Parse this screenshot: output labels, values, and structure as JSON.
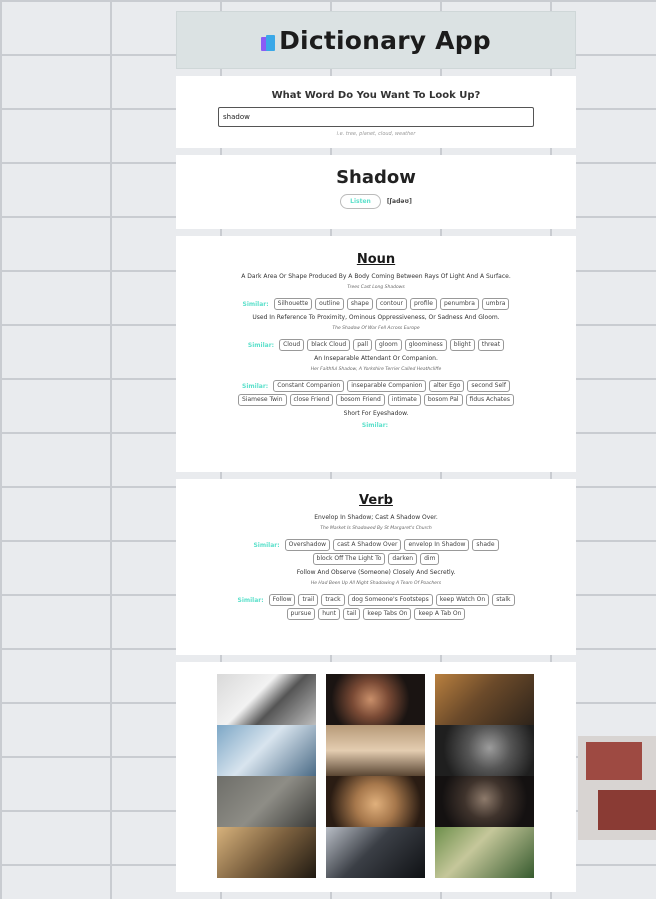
{
  "header": {
    "title": "Dictionary App",
    "icon": "books-icon"
  },
  "search": {
    "question": "What Word Do You Want To Look Up?",
    "value": "shadow",
    "hint": "i.e. tree, planet, cloud, weather"
  },
  "word": {
    "title": "Shadow",
    "listen_label": "Listen",
    "phonetic": "[ʃadəʊ]"
  },
  "noun": {
    "pos": "Noun",
    "similar_label": "Similar:",
    "meanings": [
      {
        "definition": "A Dark Area Or Shape Produced By A Body Coming Between Rays Of Light And A Surface.",
        "example": "Trees Cast Long Shadows",
        "synonyms": [
          "Silhouette",
          "outline",
          "shape",
          "contour",
          "profile",
          "penumbra",
          "umbra"
        ]
      },
      {
        "definition": "Used In Reference To Proximity, Ominous Oppressiveness, Or Sadness And Gloom.",
        "example": "The Shadow Of War Fell Across Europe",
        "synonyms": [
          "Cloud",
          "black Cloud",
          "pall",
          "gloom",
          "gloominess",
          "blight",
          "threat"
        ]
      },
      {
        "definition": "An Inseparable Attendant Or Companion.",
        "example": "Her Faithful Shadow, A Yorkshire Terrier Called Heathcliffe",
        "synonyms": [
          "Constant Companion",
          "inseparable Companion",
          "alter Ego",
          "second Self",
          "Siamese Twin",
          "close Friend",
          "bosom Friend",
          "intimate",
          "bosom Pal",
          "fidus Achates"
        ]
      },
      {
        "definition": "Short For Eyeshadow.",
        "example": "",
        "synonyms": []
      }
    ]
  },
  "verb": {
    "pos": "Verb",
    "similar_label": "Similar:",
    "meanings": [
      {
        "definition": "Envelop In Shadow; Cast A Shadow Over.",
        "example": "The Market Is Shadowed By St Margaret's Church",
        "synonyms": [
          "Overshadow",
          "cast A Shadow Over",
          "envelop In Shadow",
          "shade",
          "block Off The Light To",
          "darken",
          "dim"
        ]
      },
      {
        "definition": "Follow And Observe (Someone) Closely And Secretly.",
        "example": "He Had Been Up All Night Shadowing A Team Of Poachers",
        "synonyms": [
          "Follow",
          "trail",
          "track",
          "dog Someone's Footsteps",
          "keep Watch On",
          "stalk",
          "pursue",
          "hunt",
          "tail",
          "keep Tabs On",
          "keep A Tab On"
        ]
      }
    ]
  },
  "gallery": {
    "photos": [
      {
        "name": "photo-building-shadows",
        "bg": "linear-gradient(135deg,#d9d9d9 0%,#f2f2f2 40%,#555 60%,#bdbdbd 100%)"
      },
      {
        "name": "photo-face-light-pattern",
        "bg": "radial-gradient(circle at 45% 50%,#c98f6a 0%,#7a4a35 30%,#1a1412 65%)"
      },
      {
        "name": "photo-desk-objects",
        "bg": "linear-gradient(135deg,#b9803f 0%,#6b4a2a 45%,#2d231a 100%)"
      },
      {
        "name": "photo-woman-lying",
        "bg": "linear-gradient(135deg,#7da7c6 0%,#d8e4ee 45%,#4b6b86 100%)"
      },
      {
        "name": "photo-woman-standing",
        "bg": "linear-gradient(180deg,#b79a78 0%,#e4cdb1 50%,#5a4633 100%)"
      },
      {
        "name": "photo-portrait-dark",
        "bg": "radial-gradient(circle at 55% 45%,#9c9c9c 0%,#555 35%,#1f1f1f 75%)"
      },
      {
        "name": "photo-shadow-on-wall",
        "bg": "linear-gradient(135deg,#6e6e69 0%,#8e8d86 50%,#3b3b38 100%)"
      },
      {
        "name": "photo-hands-sunlight",
        "bg": "radial-gradient(circle at 50% 55%,#e0b07c 0%,#a7784c 35%,#2a1c13 80%)"
      },
      {
        "name": "photo-man-dark",
        "bg": "radial-gradient(circle at 50% 45%,#8d7a6b 0%,#3f332c 35%,#141111 75%)"
      },
      {
        "name": "photo-street-shadows",
        "bg": "linear-gradient(135deg,#d7b27c 0%,#7a5f3e 50%,#1f1911 100%)"
      },
      {
        "name": "photo-dark-silhouette",
        "bg": "linear-gradient(135deg,#b9bec6 0%,#3b3f46 45%,#0f1114 100%)"
      },
      {
        "name": "photo-green-aerial",
        "bg": "linear-gradient(135deg,#6d8f4b 0%,#c5c79a 40%,#365a2e 100%)"
      }
    ]
  },
  "colors": {
    "accent": "#5ce0cb",
    "header_bg": "#dbe2e3",
    "card_bg": "#ffffff"
  }
}
